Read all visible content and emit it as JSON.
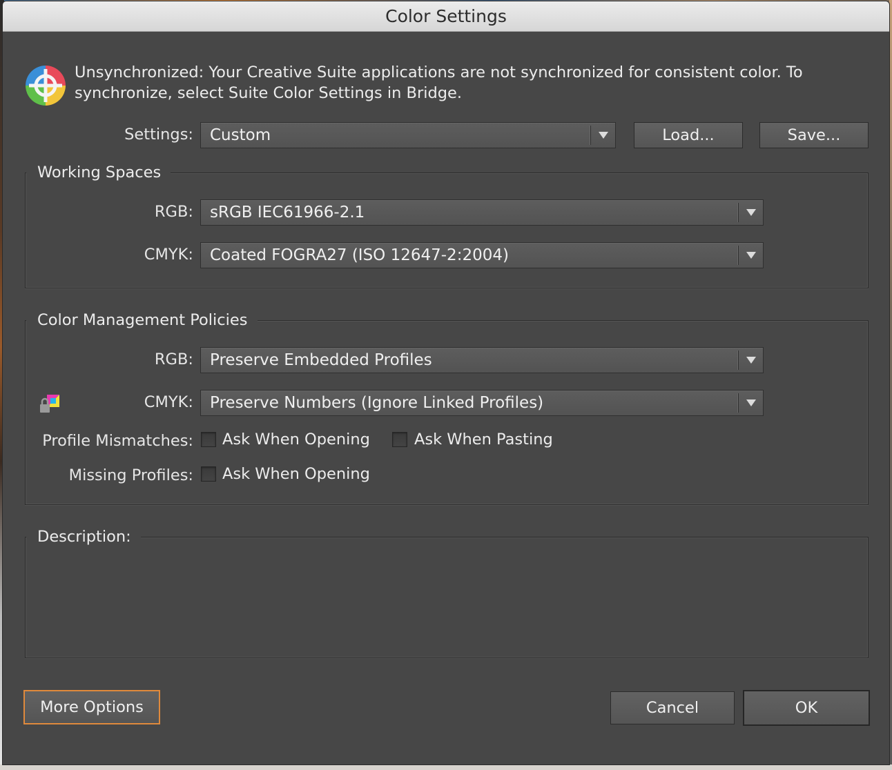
{
  "window": {
    "title": "Color Settings"
  },
  "sync": {
    "icon": "color-wheel-icon",
    "message": "Unsynchronized: Your Creative Suite applications are not synchronized for consistent color. To synchronize, select Suite Color Settings in Bridge."
  },
  "settings": {
    "label": "Settings:",
    "value": "Custom",
    "load_label": "Load...",
    "save_label": "Save..."
  },
  "working_spaces": {
    "title": "Working Spaces",
    "rgb_label": "RGB:",
    "rgb_value": "sRGB IEC61966-2.1",
    "cmyk_label": "CMYK:",
    "cmyk_value": "Coated FOGRA27 (ISO 12647-2:2004)"
  },
  "policies": {
    "title": "Color Management Policies",
    "rgb_label": "RGB:",
    "rgb_value": "Preserve Embedded Profiles",
    "cmyk_label": "CMYK:",
    "cmyk_value": "Preserve Numbers (Ignore Linked Profiles)",
    "cmyk_icon": "locked-cmyk-swatch-icon",
    "mismatch_label": "Profile Mismatches:",
    "mismatch_opening": "Ask When Opening",
    "mismatch_pasting": "Ask When Pasting",
    "missing_label": "Missing Profiles:",
    "missing_opening": "Ask When Opening"
  },
  "description": {
    "title": "Description:"
  },
  "footer": {
    "more_options": "More Options",
    "cancel": "Cancel",
    "ok": "OK"
  },
  "colors": {
    "dialog_bg": "#474747",
    "focus_ring": "#e08a3c",
    "titlebar": "#dcdcdc"
  }
}
